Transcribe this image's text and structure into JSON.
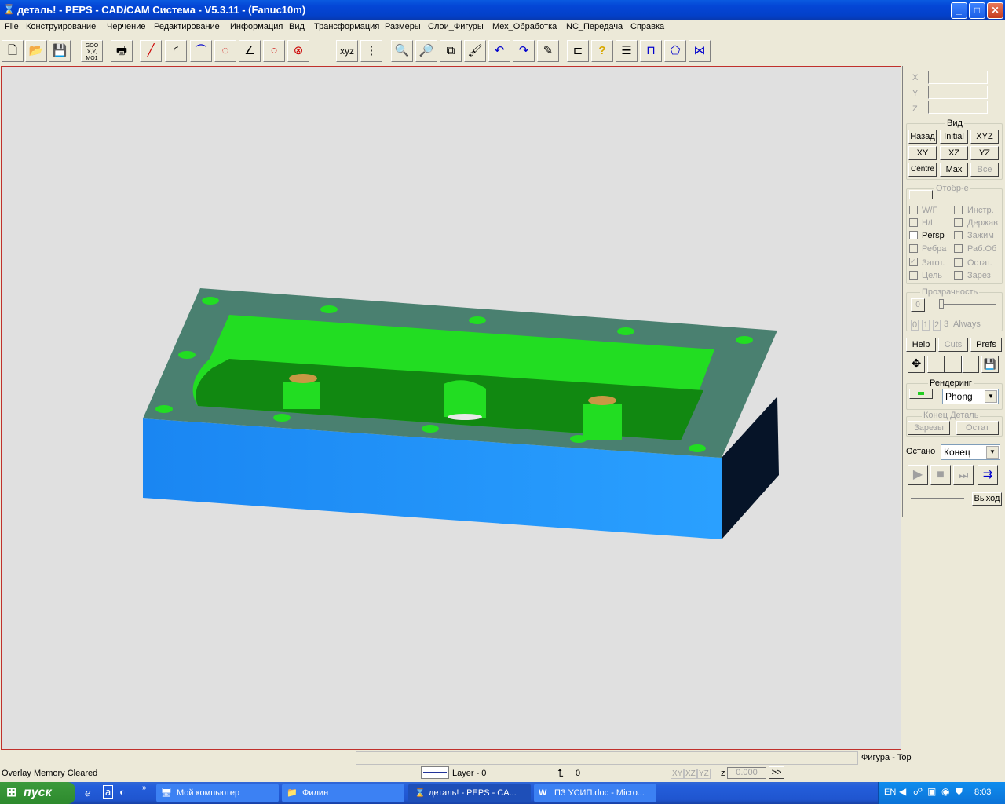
{
  "window": {
    "title": "деталь! - PEPS - CAD/CAM Система - V5.3.11 - (Fanuc10m)",
    "controls": {
      "minimize": "_",
      "maximize": "□",
      "close": "✕"
    }
  },
  "menu": [
    "File",
    "Конструирование",
    "Черчение",
    "Редактирование",
    "Информация",
    "Вид",
    "Трансформация",
    "Размеры",
    "Слои_Фигуры",
    "Мех_Обработка",
    "NC_Передача",
    "Справка"
  ],
  "toolbar": {
    "goo_label": "GOO X,Y, MO1",
    "xyz_label": "xyz",
    "icons": [
      "new-icon",
      "open-icon",
      "save-icon",
      "goo-icon",
      "print-icon",
      "line-icon",
      "arc-icon",
      "arc3-icon",
      "point-circle-icon",
      "angle-icon",
      "circle-icon",
      "cross-circle-icon",
      "xyz-icon",
      "grid-icon",
      "zoom-icon",
      "zoom-window-icon",
      "pan-icon",
      "brush-icon",
      "undo-icon",
      "redo-icon",
      "eraser-icon",
      "layer-icon",
      "help-icon",
      "list-icon",
      "profile-icon",
      "shape-icon",
      "path-icon"
    ]
  },
  "panel": {
    "coords": {
      "x_label": "X",
      "y_label": "Y",
      "z_label": "Z"
    },
    "view": {
      "title": "Вид",
      "buttons": [
        [
          "Назад",
          "Initial",
          "XYZ"
        ],
        [
          "XY",
          "XZ",
          "YZ"
        ],
        [
          "Centre",
          "Max",
          "Все"
        ]
      ]
    },
    "display": {
      "title": "Отобр-е",
      "left": [
        {
          "label": "W/F",
          "checked": false,
          "enabled": false
        },
        {
          "label": "H/L",
          "checked": false,
          "enabled": false
        },
        {
          "label": "Persp",
          "checked": false,
          "enabled": true
        },
        {
          "label": "Ребра",
          "checked": false,
          "enabled": false
        },
        {
          "label": "Загот.",
          "checked": true,
          "enabled": false
        },
        {
          "label": "Цель",
          "checked": false,
          "enabled": false
        }
      ],
      "right": [
        {
          "label": "Инстр.",
          "checked": false,
          "enabled": false
        },
        {
          "label": "Держав",
          "checked": false,
          "enabled": false
        },
        {
          "label": "Зажим",
          "checked": false,
          "enabled": false
        },
        {
          "label": "Раб.Об",
          "checked": false,
          "enabled": false
        },
        {
          "label": "Остат.",
          "checked": false,
          "enabled": false
        },
        {
          "label": "Зарез",
          "checked": false,
          "enabled": false
        }
      ]
    },
    "transparency": {
      "title": "Прозрачность",
      "value": "0",
      "levels": [
        "0",
        "1",
        "2",
        "3"
      ],
      "always": "Always"
    },
    "buttons3": [
      "Help",
      "Cuts",
      "Prefs"
    ],
    "rendering": {
      "title": "Рендеринг",
      "mode": "Phong"
    },
    "endpart": {
      "title": "Конец Деталь",
      "cuts": "Зарезы",
      "rest": "Остат"
    },
    "stop": {
      "label": "Остано",
      "mode": "Конец"
    },
    "exit": "Выход"
  },
  "status": {
    "message": "Overlay Memory Cleared",
    "figure": "Фигура  - Top",
    "layer": "Layer - 0",
    "pointer": "0",
    "planes": [
      "XY",
      "XZ",
      "YZ"
    ],
    "z_label": "z",
    "z_value": "0.000",
    "more": ">>"
  },
  "taskbar": {
    "start": "пуск",
    "tasks": [
      {
        "label": "Мой компьютер",
        "active": false
      },
      {
        "label": "Филин",
        "active": false
      },
      {
        "label": "деталь! - PEPS - CA...",
        "active": true
      },
      {
        "label": "ПЗ УСИП.doc - Micro...",
        "active": false
      }
    ],
    "lang": "EN",
    "clock": "8:03"
  },
  "colors": {
    "part_side": "#1e90ff",
    "part_top": "#4a8070",
    "pocket": "#22dd22",
    "pocket_floor": "#118811",
    "dark_side": "#061428",
    "viewport_bg": "#e0e0e0",
    "viewport_border": "#c0302c"
  }
}
